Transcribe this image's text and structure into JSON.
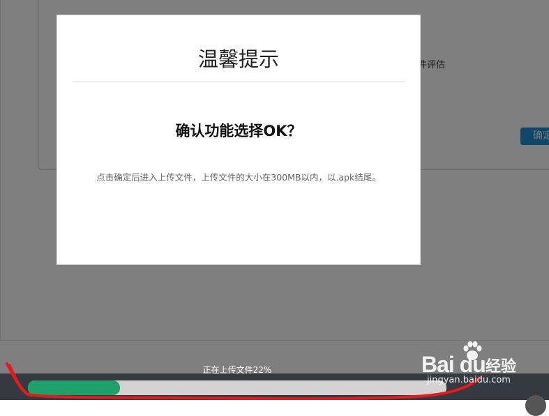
{
  "background": {
    "partial_label": "件评估",
    "confirm_button_partial": "确定"
  },
  "modal": {
    "title": "温馨提示",
    "heading": "确认功能选择OK？",
    "body": "点击确定后进入上传文件，上传文件的大小在300MB以内，以.apk结尾。"
  },
  "upload": {
    "status_text": "正在上传文件22%",
    "progress_fraction": 0.22,
    "fill_color": "#1ea06b"
  },
  "annotation": {
    "stroke_color": "#e8191d"
  },
  "watermark": {
    "logo_text": "Bai du",
    "chinese_text": "经验",
    "url_text": "jingyan.baidu.com"
  }
}
